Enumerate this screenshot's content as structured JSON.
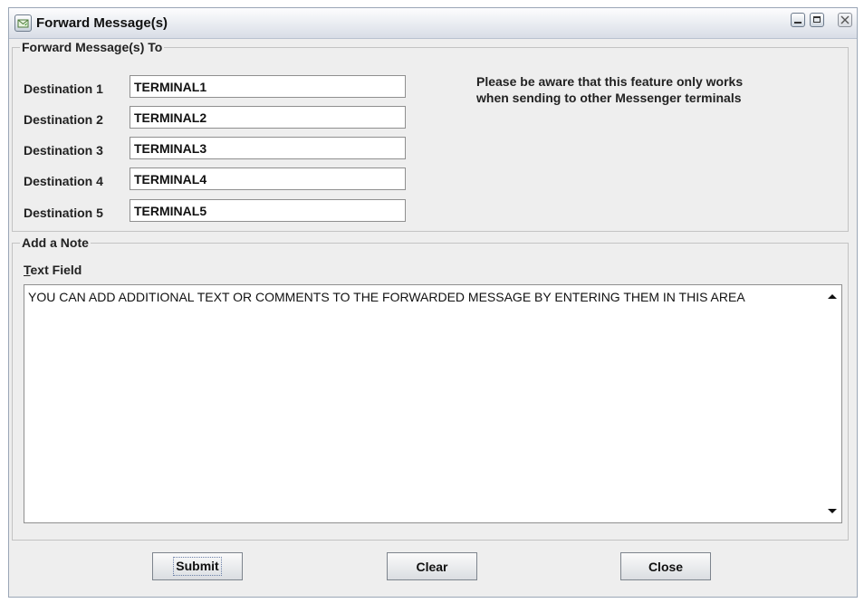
{
  "window": {
    "title": "Forward Message(s)"
  },
  "forward_group": {
    "legend": "Forward Message(s) To",
    "destinations": [
      {
        "label": "Destination 1",
        "value": "TERMINAL1"
      },
      {
        "label": "Destination 2",
        "value": "TERMINAL2"
      },
      {
        "label": "Destination 3",
        "value": "TERMINAL3"
      },
      {
        "label": "Destination 4",
        "value": "TERMINAL4"
      },
      {
        "label": "Destination 5",
        "value": "TERMINAL5"
      }
    ],
    "notice_line1": "Please be aware that this feature only works",
    "notice_line2": "when sending to other Messenger terminals"
  },
  "note_group": {
    "legend": "Add a Note",
    "field_label_mnemonic": "T",
    "field_label_rest": "ext Field",
    "text": "YOU CAN ADD ADDITIONAL TEXT OR COMMENTS TO THE FORWARDED MESSAGE BY ENTERING THEM IN THIS AREA"
  },
  "buttons": {
    "submit": "Submit",
    "clear": "Clear",
    "close": "Close"
  },
  "icons": {
    "app": "envelope-icon",
    "minimize": "minimize-icon",
    "maximize": "maximize-icon",
    "close": "close-icon",
    "scroll_up": "scroll-up-arrow-icon",
    "scroll_down": "scroll-down-arrow-icon"
  }
}
